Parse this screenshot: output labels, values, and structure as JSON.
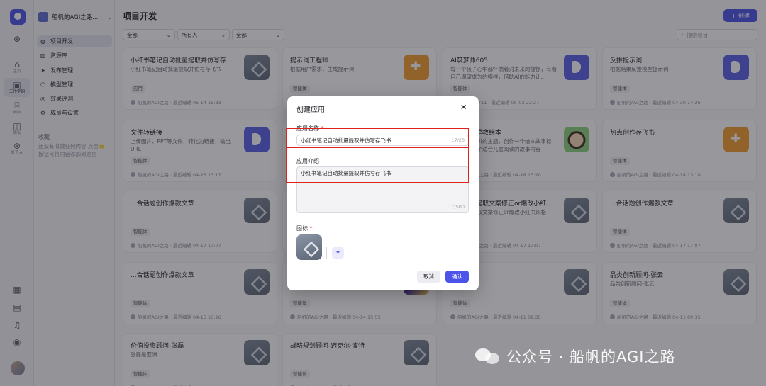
{
  "rail": {
    "items": [
      {
        "icon": "plus-icon",
        "label": ""
      },
      {
        "icon": "home-icon",
        "label": "主页"
      },
      {
        "icon": "terminal-icon",
        "label": "工作空间"
      },
      {
        "icon": "store-icon",
        "label": "商店"
      },
      {
        "icon": "template-icon",
        "label": "模板"
      },
      {
        "icon": "assistant-icon",
        "label": "扣子·AI"
      }
    ],
    "notification_count": "0"
  },
  "workspace": {
    "name": "船帆的AGI之路..."
  },
  "sidebar": {
    "items": [
      {
        "label": "项目开发",
        "icon": "project-icon"
      },
      {
        "label": "资源库",
        "icon": "library-icon"
      },
      {
        "label": "发布管理",
        "icon": "send-icon"
      },
      {
        "label": "模型管理",
        "icon": "model-icon"
      },
      {
        "label": "效果评测",
        "icon": "eval-icon"
      },
      {
        "label": "成员与设置",
        "icon": "members-icon"
      }
    ],
    "favorites_title": "收藏",
    "favorites_hint": "还没有收藏任何内容 点击⭐按钮可将内容添加到这里~"
  },
  "header": {
    "title": "项目开发",
    "create_label": "创建"
  },
  "filters": [
    {
      "value": "全部"
    },
    {
      "value": "所有人"
    },
    {
      "value": "全部"
    }
  ],
  "search": {
    "placeholder": "搜索项目"
  },
  "cards": [
    {
      "title": "小红书笔记自动批量提取并仿写存...",
      "desc": "小红书笔记自动批量提取并仿写存飞书",
      "tag": "应用",
      "meta": "船帆的AGI之路 · 最近编辑 05-14 15:33",
      "icon": "layers-icon",
      "style": "ic-gray"
    },
    {
      "title": "提示词工程师",
      "desc": "根据用户需求，生成提示词",
      "tag": "智能体",
      "meta": "船帆的AGI之路 · 最近编辑 04-30 10:10",
      "icon": "puzzle-icon",
      "style": "ic-orange"
    },
    {
      "title": "AI筑梦师605",
      "desc": "每一个孩子心中都怀揣着对未来的憧憬，有着自己渴望成为的模样，借助AI的能力让...",
      "tag": "智能体",
      "meta": "2106257711 · 最近编辑 05-03 22:27",
      "icon": "bot-icon",
      "style": "ic-indigo"
    },
    {
      "title": "反推提示词",
      "desc": "根据结果反推模型提示词",
      "tag": "智能体",
      "meta": "船帆的AGI之路 · 最近编辑 04-30 14:26",
      "icon": "bot-icon",
      "style": "ic-indigo"
    },
    {
      "title": "文件转链接",
      "desc": "上传图片、PPT等文件，转化为链接，输出URL",
      "tag": "智能体",
      "meta": "船帆的AGI之路 · 最近编辑 04-23 13:17",
      "icon": "bot-icon",
      "style": "ic-indigo"
    },
    {
      "title": "...4",
      "desc": "...直接换脸",
      "tag": "智能体",
      "meta": "2106257711 · 最近编辑 04-20 09:14",
      "icon": "portrait-icon",
      "style": "ic-face"
    },
    {
      "title": "儿童益智早教绘本",
      "desc": "根据用户提供的主题，创作一个绘本故事标题，编写一个适合儿童阅读的故事内容",
      "tag": "智能体",
      "meta": "船帆的AGI之路 · 最近编辑 04-18 13:20",
      "icon": "kid-icon",
      "style": "ic-kid"
    },
    {
      "title": "热点创作存飞书",
      "desc": "",
      "tag": "智能体",
      "meta": "船帆的AGI之路 · 最近编辑 04-18 13:10",
      "icon": "puzzle-icon",
      "style": "ic-orange"
    },
    {
      "title": "...合话题创作爆款文章",
      "desc": "",
      "tag": "智能体",
      "meta": "船帆的AGI之路 · 最近编辑 04-17 17:07",
      "icon": "layers-icon",
      "style": "ic-gray"
    },
    {
      "title": "老祖宗回答我",
      "desc": "老祖宗回答我文案创作",
      "tag": "智能体",
      "meta": "船帆的AGI之路 · 最近编辑 04-17 17:07",
      "icon": "chat-icon",
      "style": "ic-teal"
    },
    {
      "title": "抖音视频提取文案修正or爆改小红...",
      "desc": "抖音视频提取文案修正or爆改小红书风格",
      "tag": "智能体",
      "meta": "船帆的AGI之路 · 最近编辑 04-17 17:07",
      "icon": "layers-icon",
      "style": "ic-gray"
    },
    {
      "title": "...合话题创作爆款文章",
      "desc": "",
      "tag": "智能体",
      "meta": "船帆的AGI之路 · 最近编辑 04-17 17:07",
      "icon": "layers-icon",
      "style": "ic-gray"
    },
    {
      "title": "...合话题创作爆款文章",
      "desc": "",
      "tag": "智能体",
      "meta": "船帆的AGI之路 · 最近编辑 04-15 10:26",
      "icon": "layers-icon",
      "style": "ic-gray"
    },
    {
      "title": "带文字的创意海报生成助手",
      "desc": "用户输入中文字体，生成海报",
      "tag": "智能体",
      "meta": "船帆的AGI之路 · 最近编辑 04-14 15:55",
      "icon": "poster-icon",
      "style": "ic-poster"
    },
    {
      "title": "智能扩图",
      "desc": "",
      "tag": "智能体",
      "meta": "船帆的AGI之路 · 最近编辑 04-11 09:35",
      "icon": "layers-icon",
      "style": "ic-gray"
    },
    {
      "title": "品类创新顾问-张云",
      "desc": "品类创新顾问-张云",
      "tag": "智能体",
      "meta": "船帆的AGI之路 · 最近编辑 04-11 09:35",
      "icon": "layers-icon",
      "style": "ic-gray"
    },
    {
      "title": "价值投资顾问-张磊",
      "desc": "张磊是亚洲...",
      "tag": "智能体",
      "meta": "船帆的AGI之路 · 最近编辑 04-11 09:33",
      "icon": "layers-icon",
      "style": "ic-gray"
    },
    {
      "title": "战略规划顾问-迈克尔·波特",
      "desc": "",
      "tag": "智能体",
      "meta": "船帆的AGI之路 · 最近编辑 04-11 09:31",
      "icon": "layers-icon",
      "style": "ic-gray"
    }
  ],
  "modal": {
    "title": "创建应用",
    "name_label": "应用名称",
    "name_value": "小红书笔记自动批量提取并仿写存飞书",
    "name_count": "17/20",
    "desc_label": "应用介绍",
    "desc_value": "小红书笔记自动批量提取并仿写存飞书",
    "desc_count": "17/500",
    "icon_label": "图标",
    "cancel_label": "取消",
    "ok_label": "确认"
  },
  "watermark": {
    "text": "公众号 · 船帆的AGI之路"
  },
  "colors": {
    "accent": "#4d53e8",
    "highlight": "#e0221d",
    "required": "#e53935"
  }
}
